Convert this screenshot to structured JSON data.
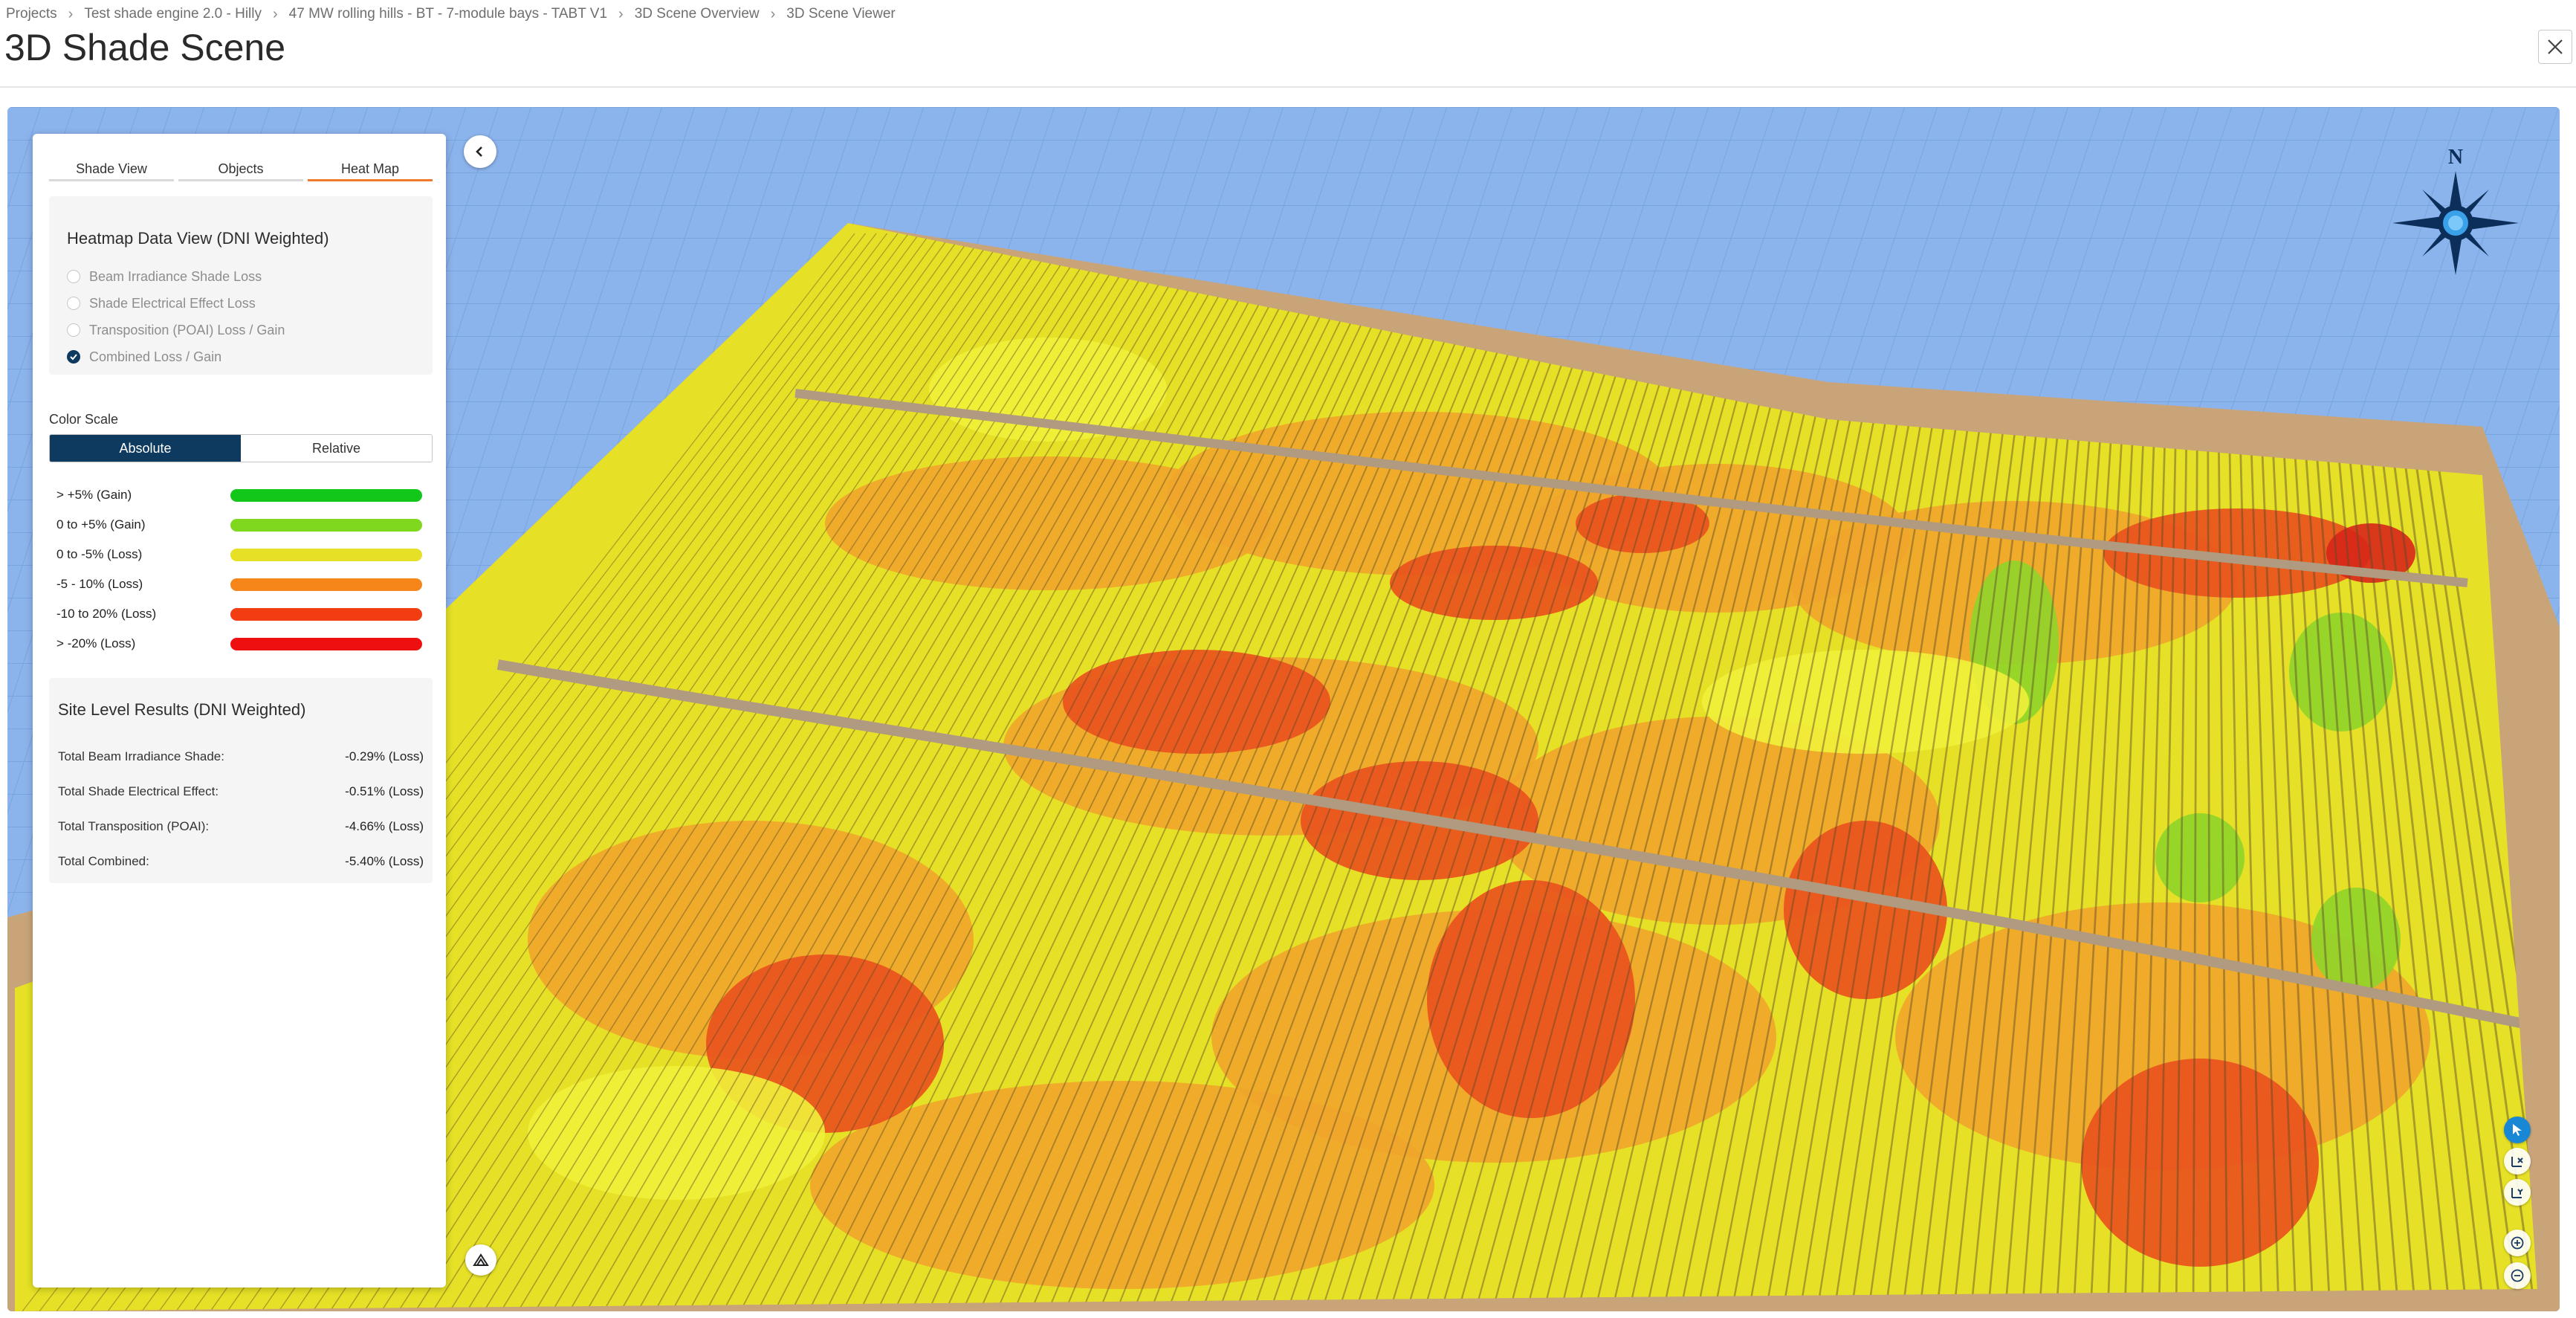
{
  "breadcrumb": [
    {
      "label": "Projects"
    },
    {
      "label": "Test shade engine 2.0 - Hilly"
    },
    {
      "label": "47 MW rolling hills - BT - 7-module bays - TABT V1"
    },
    {
      "label": "3D Scene Overview"
    },
    {
      "label": "3D Scene Viewer"
    }
  ],
  "page_title": "3D Shade Scene",
  "icons": {
    "close": "close-icon",
    "collapse": "chevron-left-icon",
    "viewcube": "view-cube-icon",
    "compass": "compass-icon",
    "select": "pointer-select-icon",
    "measure_x": "axis-x-icon",
    "measure_y": "axis-y-icon",
    "zoom_in": "zoom-in-icon",
    "zoom_out": "zoom-out-icon"
  },
  "panel": {
    "tabs": [
      {
        "label": "Shade View",
        "active": false
      },
      {
        "label": "Objects",
        "active": false
      },
      {
        "label": "Heat Map",
        "active": true
      }
    ],
    "heatmap_title": "Heatmap Data View (DNI Weighted)",
    "options": [
      {
        "label": "Beam Irradiance Shade Loss",
        "checked": false
      },
      {
        "label": "Shade Electrical Effect Loss",
        "checked": false
      },
      {
        "label": "Transposition (POAI) Loss / Gain",
        "checked": false
      },
      {
        "label": "Combined Loss / Gain",
        "checked": true
      }
    ],
    "color_scale_label": "Color Scale",
    "scale_modes": [
      {
        "label": "Absolute",
        "active": true
      },
      {
        "label": "Relative",
        "active": false
      }
    ],
    "legend": [
      {
        "label": "> +5% (Gain)",
        "color": "#12c71a"
      },
      {
        "label": "0 to +5% (Gain)",
        "color": "#7fd81e"
      },
      {
        "label": "0 to -5% (Loss)",
        "color": "#e6e126"
      },
      {
        "label": "-5 - 10% (Loss)",
        "color": "#f7861a"
      },
      {
        "label": "-10 to 20% (Loss)",
        "color": "#f23c12"
      },
      {
        "label": "> -20% (Loss)",
        "color": "#ee1010"
      }
    ],
    "results_title": "Site Level Results (DNI Weighted)",
    "results": [
      {
        "label": "Total Beam Irradiance Shade:",
        "value": "-0.29% (Loss)"
      },
      {
        "label": "Total Shade Electrical Effect:",
        "value": "-0.51% (Loss)"
      },
      {
        "label": "Total Transposition (POAI):",
        "value": "-4.66% (Loss)"
      },
      {
        "label": "Total Combined:",
        "value": "-5.40% (Loss)"
      }
    ]
  },
  "scene": {
    "colors": {
      "sky_grid": "#8cb4ec",
      "ground": "#c9a479",
      "road": "#b09a80",
      "ok": "#e6e126",
      "ok_light": "#f1f13a",
      "loss": "#f0a52a",
      "loss_high": "#e9501d",
      "loss_severe": "#d8261a",
      "gain": "#8fd42a"
    },
    "compass_label": "N"
  }
}
